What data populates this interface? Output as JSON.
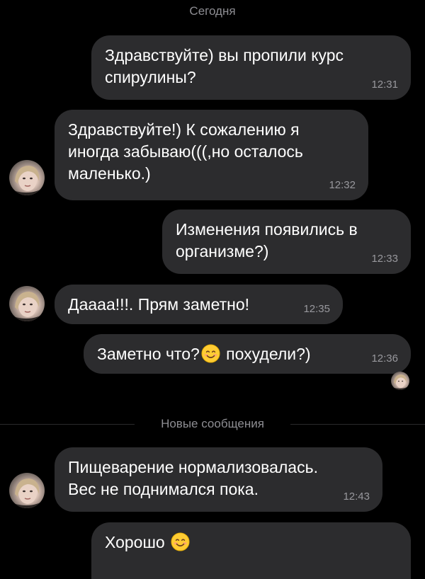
{
  "chat": {
    "date_separator": "Сегодня",
    "new_messages_divider": "Новые сообщения",
    "messages": [
      {
        "direction": "outgoing",
        "lines": [
          "Здравствуйте) вы пропили курс",
          "спирулины?"
        ],
        "time": "12:31"
      },
      {
        "direction": "incoming",
        "lines": [
          "Здравствуйте!) К сожалению я",
          "иногда забываю(((,но осталось",
          "маленько.)"
        ],
        "time": "12:32"
      },
      {
        "direction": "outgoing",
        "lines": [
          "Изменения появились в",
          "организме?)"
        ],
        "time": "12:33"
      },
      {
        "direction": "incoming",
        "lines": [
          "Даааа!!!. Прям заметно!"
        ],
        "time": "12:35"
      },
      {
        "direction": "outgoing",
        "text_before_emoji": "Заметно что?",
        "emoji": "smiling-face-emoji",
        "text_after_emoji": " похудели?)",
        "time": "12:36",
        "read_receipt": "avatar-read-receipt"
      },
      {
        "direction": "incoming",
        "lines": [
          "Пищеварение нормализовалась.",
          "Вес не поднимался пока."
        ],
        "time": "12:43"
      },
      {
        "direction": "outgoing",
        "text_before_emoji": "Хорошо",
        "emoji": "smiling-face-emoji"
      }
    ]
  },
  "colors": {
    "background": "#000000",
    "bubble": "#2c2c2e",
    "text": "#ffffff",
    "meta_text": "#8e8e93"
  }
}
